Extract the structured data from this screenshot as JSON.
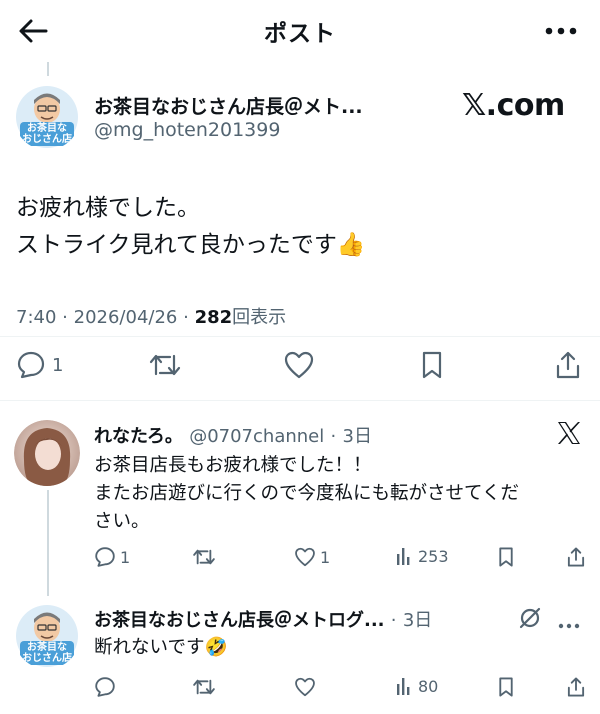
{
  "header": {
    "title": "ポスト",
    "back_icon": "arrow-left-icon",
    "more_icon": "more-horizontal-icon"
  },
  "main_post": {
    "author_name": "お茶目なおじさん店長＠メト...",
    "author_handle": "@mg_hoten201399",
    "avatar_text_1": "お茶目な",
    "avatar_text_2": "おじさん店",
    "source_logo": "𝕏.com",
    "body_line1": "お疲れ様でした。",
    "body_line2": "ストライク見れて良かったです👍",
    "time": "7:40",
    "sep1": "·",
    "date": "2026/04/26",
    "sep2": "·",
    "views_count": "282",
    "views_label": "回表示",
    "reply_count": "1"
  },
  "replies": [
    {
      "author_name": "れなたろ。",
      "author_handle": "@0707channel",
      "sep": "·",
      "time": "3日",
      "text_line1": "お茶目店長もお疲れ様でした！！",
      "text_line2": "またお店遊びに行くので今度私にも転がさせてくだ",
      "text_line3": "さい。",
      "reply_count": "1",
      "like_count": "1",
      "views_count": "253"
    },
    {
      "author_name": "お茶目なおじさん店長＠メトログ...",
      "sep": "·",
      "time": "3日",
      "text_line1": "断れないです🤣",
      "views_count": "80",
      "avatar_text_1": "お茶目な",
      "avatar_text_2": "おじさん店"
    }
  ],
  "colors": {
    "text": "#0f1419",
    "secondary": "#536471",
    "divider": "#eff3f4",
    "thread_line": "#cfd9de",
    "avatar_bg": "#5ba8de"
  }
}
